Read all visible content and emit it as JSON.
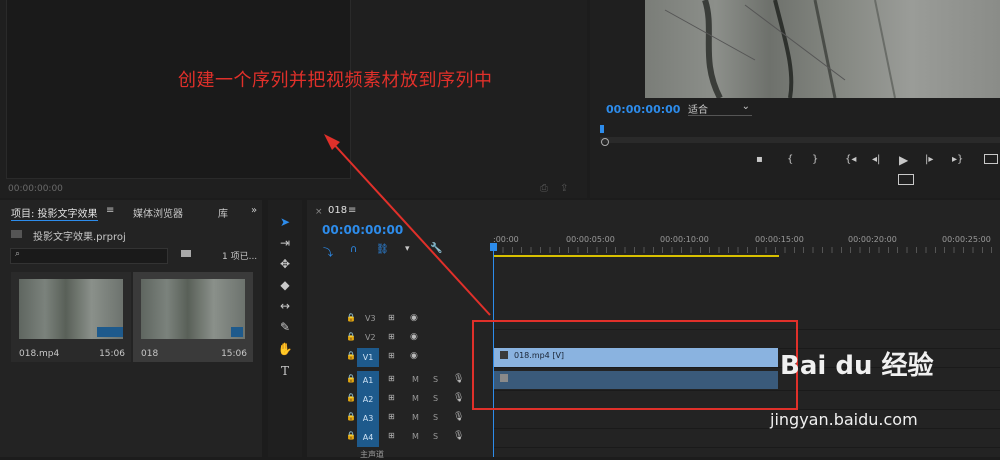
{
  "annotation": "创建一个序列并把视频素材放到序列中",
  "source_monitor": {
    "timecode": "00:00:00:00"
  },
  "program_monitor": {
    "timecode": "00:00:00:00",
    "fit_label": "适合",
    "controls": [
      "▪",
      "{",
      "}",
      "{◂",
      "◂|",
      "▶",
      "|▸",
      "▸}"
    ]
  },
  "project_panel": {
    "tabs": [
      "项目: 投影文字效果",
      "媒体浏览器",
      "库"
    ],
    "file": "投影文字效果.prproj",
    "count": "1 项已...",
    "items": [
      {
        "name": "018.mp4",
        "duration": "15:06"
      },
      {
        "name": "018",
        "duration": "15:06"
      }
    ]
  },
  "timeline": {
    "sequence_name": "018",
    "timecode": "00:00:00:00",
    "ruler": [
      ":00:00",
      "00:00:05:00",
      "00:00:10:00",
      "00:00:15:00",
      "00:00:20:00",
      "00:00:25:00"
    ],
    "video_tracks": [
      "V3",
      "V2",
      "V1"
    ],
    "audio_tracks": [
      "A1",
      "A2",
      "A3",
      "A4"
    ],
    "v1_src": "V1",
    "a1_src": "A1",
    "mute_label": "M",
    "solo_label": "S",
    "master_label": "主声道",
    "clip_video": "018.mp4 [V]"
  },
  "watermark": {
    "brand": "Bai du 经验",
    "url": "jingyan.baidu.com"
  },
  "colors": {
    "accent": "#2d8ceb",
    "annotation": "#e0302a",
    "clip_video": "#8ab3e0",
    "workarea": "#d8c000"
  }
}
